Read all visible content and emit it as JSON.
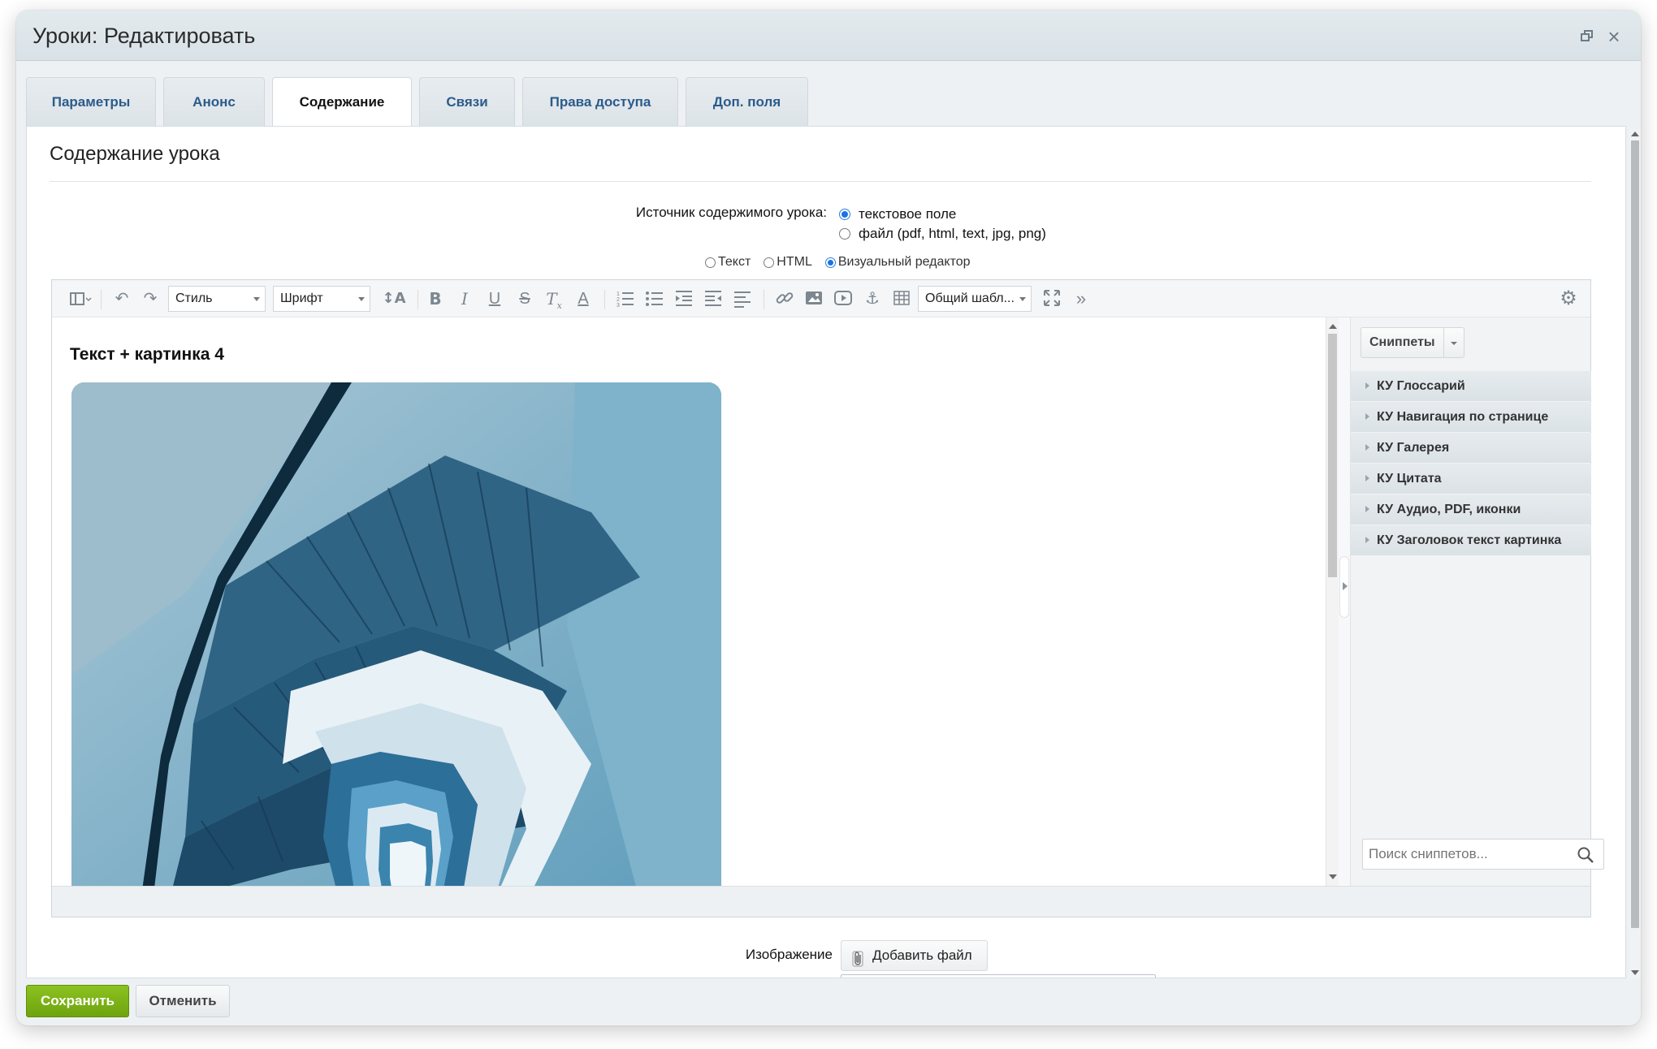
{
  "dialog": {
    "title": "Уроки: Редактировать"
  },
  "tabs": [
    {
      "label": "Параметры"
    },
    {
      "label": "Анонс"
    },
    {
      "label": "Содержание",
      "active": true
    },
    {
      "label": "Связи"
    },
    {
      "label": "Права доступа"
    },
    {
      "label": "Доп. поля"
    }
  ],
  "section": {
    "title": "Содержание урока",
    "source_label": "Источник содержимого урока:",
    "source_options": [
      {
        "label": "текстовое поле",
        "selected": true
      },
      {
        "label": "файл (pdf, html, text, jpg, png)",
        "selected": false
      }
    ],
    "editor_modes": [
      {
        "label": "Текст",
        "selected": false
      },
      {
        "label": "HTML",
        "selected": false
      },
      {
        "label": "Визуальный редактор",
        "selected": true
      }
    ]
  },
  "toolbar": {
    "style_select": "Стиль",
    "font_select": "Шрифт",
    "template_select": "Общий шабл...",
    "icons": [
      "sidebar-toggle-icon",
      "undo-icon",
      "redo-icon",
      "font-size-icon",
      "bold-icon",
      "italic-icon",
      "underline-icon",
      "strikethrough-icon",
      "remove-format-icon",
      "text-color-icon",
      "ordered-list-icon",
      "unordered-list-icon",
      "indent-icon",
      "outdent-icon",
      "align-icon",
      "link-icon",
      "image-icon",
      "video-icon",
      "anchor-icon",
      "table-icon",
      "fullscreen-icon",
      "more-icon",
      "settings-icon"
    ]
  },
  "content": {
    "heading": "Текст + картинка 4"
  },
  "snippets": {
    "button_label": "Сниппеты",
    "items": [
      "КУ Глоссарий",
      "КУ Навигация по странице",
      "КУ Галерея",
      "КУ Цитата",
      "КУ Аудио, PDF, иконки",
      "КУ Заголовок текст картинка"
    ],
    "search_placeholder": "Поиск сниппетов..."
  },
  "image_field": {
    "label": "Изображение",
    "add_file_label": "Добавить файл",
    "value": ""
  },
  "footer": {
    "save_label": "Сохранить",
    "cancel_label": "Отменить"
  },
  "colors": {
    "accent_green": "#7ab317",
    "tab_link": "#2b5b8b",
    "radio_on": "#1a73e8"
  }
}
